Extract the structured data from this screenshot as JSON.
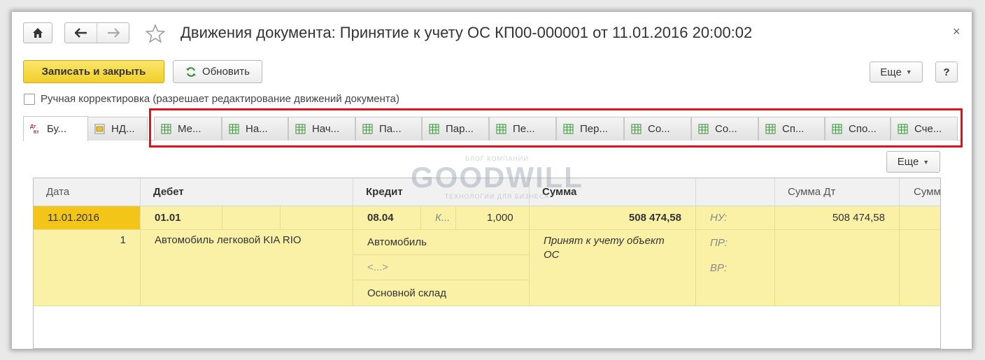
{
  "window": {
    "title": "Движения документа: Принятие к учету ОС КП00-000001 от 11.01.2016 20:00:02",
    "close_glyph": "×"
  },
  "toolbar": {
    "save_close_label": "Записать и закрыть",
    "refresh_label": "Обновить",
    "more_label": "Еще",
    "help_label": "?"
  },
  "manual_correction_label": "Ручная корректировка (разрешает редактирование движений документа)",
  "tabs": [
    {
      "label": "Бу...",
      "icon": "dt-kt-icon"
    },
    {
      "label": "НД...",
      "icon": "vat-register-icon"
    },
    {
      "label": "Ме...",
      "icon": "register-grid-icon"
    },
    {
      "label": "На...",
      "icon": "register-grid-icon"
    },
    {
      "label": "Нач...",
      "icon": "register-grid-icon"
    },
    {
      "label": "Па...",
      "icon": "register-grid-icon"
    },
    {
      "label": "Пар...",
      "icon": "register-grid-icon"
    },
    {
      "label": "Пе...",
      "icon": "register-grid-icon"
    },
    {
      "label": "Пер...",
      "icon": "register-grid-icon"
    },
    {
      "label": "Со...",
      "icon": "register-grid-icon"
    },
    {
      "label": "Со...",
      "icon": "register-grid-icon"
    },
    {
      "label": "Сп...",
      "icon": "register-grid-icon"
    },
    {
      "label": "Спо...",
      "icon": "register-grid-icon"
    },
    {
      "label": "Сче...",
      "icon": "register-grid-icon"
    }
  ],
  "watermark": {
    "top": "БЛОГ КОМПАНИИ",
    "brand": "GOODWILL",
    "bottom": "ТЕХНОЛОГИИ ДЛЯ БИЗНЕСА"
  },
  "grid": {
    "more_label": "Еще",
    "headers": {
      "date": "Дата",
      "debit": "Дебет",
      "credit": "Кредит",
      "sum": "Сумма",
      "empty": "",
      "sum_dt": "Сумма Дт",
      "sum_kt": "Сумм"
    },
    "row": {
      "date": "11.01.2016",
      "line_no": "1",
      "debit_account": "01.01",
      "debit_subconto": "Автомобиль легковой KIA RIO",
      "credit_account": "08.04",
      "credit_extra": "К...",
      "quantity": "1,000",
      "credit_subconto1": "Автомобиль",
      "credit_subconto2": "<...>",
      "credit_subconto3": "Основной склад",
      "amount": "508 474,58",
      "content": "Принят к учету объект ОС",
      "nu_label": "НУ:",
      "pr_label": "ПР:",
      "vr_label": "ВР:",
      "sum_dt": "508 474,58"
    }
  }
}
